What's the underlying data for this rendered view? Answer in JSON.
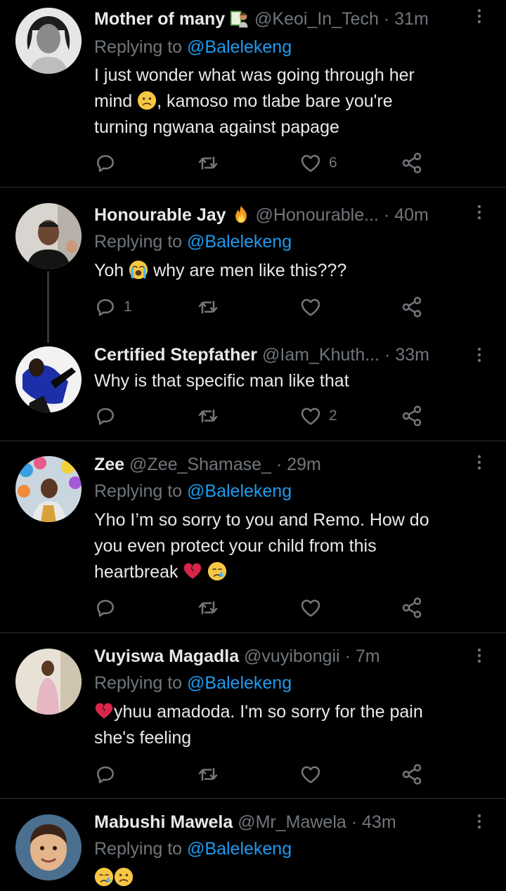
{
  "replying_prefix": "Replying to",
  "tweets": [
    {
      "name": "Mother of many",
      "handle": "@Keoi_In_Tech",
      "time": "31m",
      "reply_to": "@Balelekeng",
      "lines": [
        "I just wonder what was going through her",
        "mind",
        ", kamoso mo tlabe bare you're",
        "turning ngwana against papage"
      ],
      "reply_count": "",
      "retweet_count": "",
      "like_count": "6",
      "name_emoji": "woman-student-emoji",
      "body_emoji": "frowning-face-emoji"
    },
    {
      "name": "Honourable Jay",
      "handle": "@Honourable...",
      "time": "40m",
      "reply_to": "@Balelekeng",
      "line_a": "Yoh",
      "line_b": "why are men like this???",
      "reply_count": "1",
      "retweet_count": "",
      "like_count": "",
      "name_emoji": "fire-emoji",
      "body_emoji": "loudly-crying-face-emoji"
    },
    {
      "name": "Certified Stepfather",
      "handle": "@Iam_Khuth...",
      "time": "33m",
      "text": "Why is that specific man like that",
      "reply_count": "",
      "retweet_count": "",
      "like_count": "2"
    },
    {
      "name": "Zee",
      "handle": "@Zee_Shamase_",
      "time": "29m",
      "reply_to": "@Balelekeng",
      "lines": [
        "Yho I’m so sorry to you and Remo. How do",
        "you even protect your child from this",
        "heartbreak"
      ],
      "reply_count": "",
      "retweet_count": "",
      "like_count": "",
      "body_emojis": [
        "broken-heart-emoji",
        "crying-face-emoji"
      ]
    },
    {
      "name": "Vuyiswa Magadla",
      "handle": "@vuyibongii",
      "time": "7m",
      "reply_to": "@Balelekeng",
      "lines": [
        "yhuu amadoda. I'm so sorry for the pain",
        "she's feeling"
      ],
      "reply_count": "",
      "retweet_count": "",
      "like_count": "",
      "body_emoji": "broken-heart-emoji"
    },
    {
      "name": "Mabushi Mawela",
      "handle": "@Mr_Mawela",
      "time": "43m",
      "reply_to": "@Balelekeng",
      "body_emojis": [
        "crying-face-emoji",
        "frowning-face-emoji"
      ]
    }
  ],
  "colors": {
    "background": "#000000",
    "text": "#e7e9ea",
    "muted": "#71767b",
    "link": "#1d9bf0",
    "divider": "#2f3336"
  },
  "icons": [
    "reply-icon",
    "retweet-icon",
    "like-icon",
    "share-icon",
    "more-icon"
  ]
}
